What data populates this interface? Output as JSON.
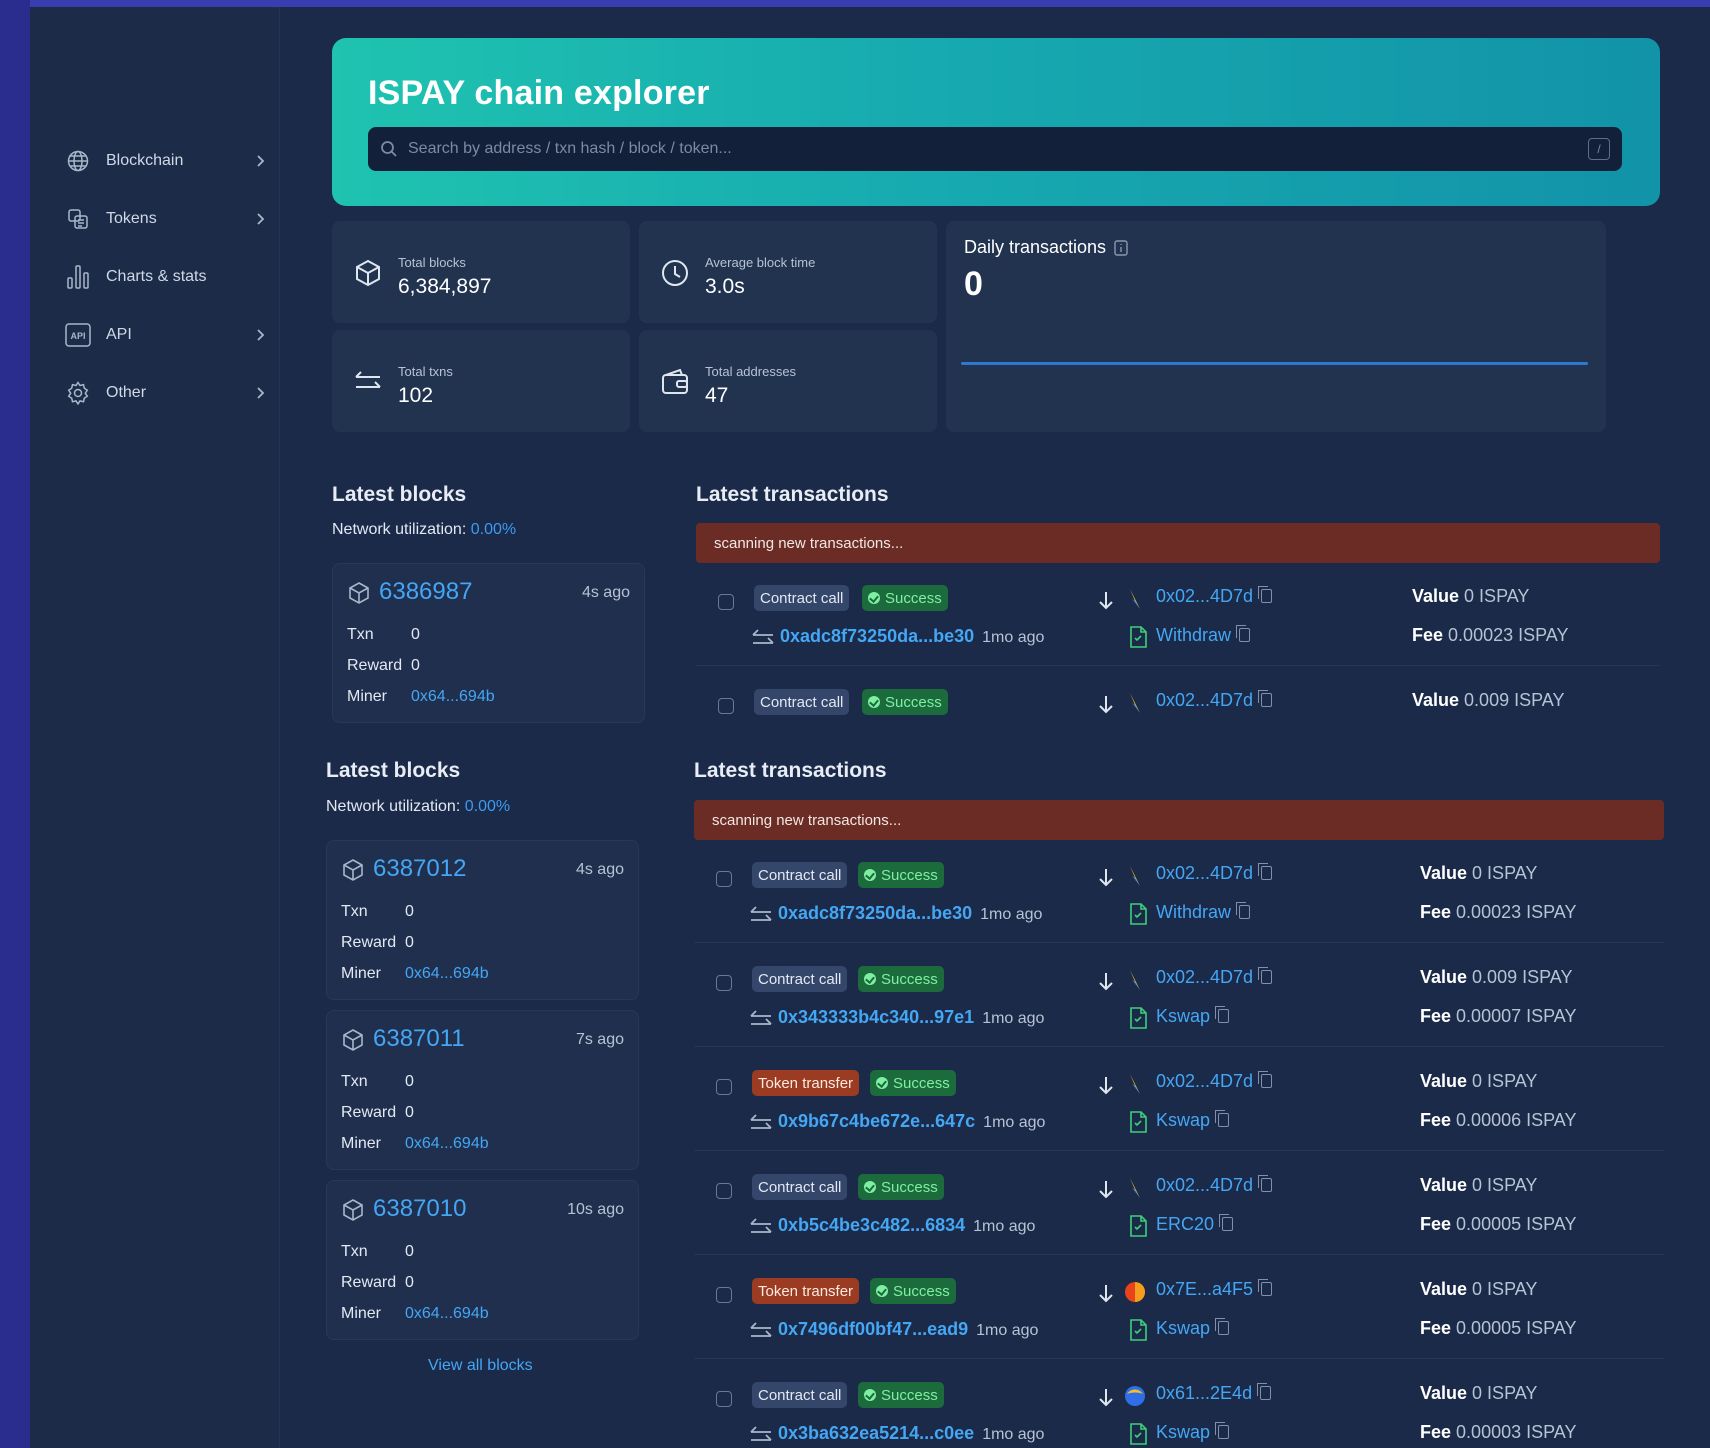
{
  "sidebar": {
    "items": [
      {
        "label": "Blockchain",
        "icon": "globe-icon",
        "has_chevron": true
      },
      {
        "label": "Tokens",
        "icon": "tokens-icon",
        "has_chevron": true
      },
      {
        "label": "Charts & stats",
        "icon": "chart-icon",
        "has_chevron": false
      },
      {
        "label": "API",
        "icon": "api-icon",
        "has_chevron": true
      },
      {
        "label": "Other",
        "icon": "gear-icon",
        "has_chevron": true
      }
    ]
  },
  "hero": {
    "title": "ISPAY chain explorer",
    "search_placeholder": "Search by address / txn hash / block / token...",
    "shortcut_key": "/"
  },
  "stats": {
    "total_blocks": {
      "label": "Total blocks",
      "value": "6,384,897"
    },
    "avg_block_time": {
      "label": "Average block time",
      "value": "3.0s"
    },
    "total_txns": {
      "label": "Total txns",
      "value": "102"
    },
    "total_addresses": {
      "label": "Total addresses",
      "value": "47"
    },
    "daily_transactions": {
      "label": "Daily transactions",
      "value": "0"
    }
  },
  "labels": {
    "txn": "Txn",
    "reward": "Reward",
    "miner": "Miner",
    "value": "Value",
    "fee": "Fee"
  },
  "panel_top": {
    "blocks_title": "Latest blocks",
    "network_utilization_label": "Network utilization:",
    "network_utilization_value": "0.00%",
    "transactions_title": "Latest transactions",
    "scanning_text": "scanning new transactions...",
    "blocks": [
      {
        "number": "6386987",
        "age": "4s ago",
        "txn": "0",
        "reward": "0",
        "miner": "0x64...694b"
      }
    ],
    "transactions": [
      {
        "type": "Contract call",
        "type_color": "#34466a",
        "status": "Success",
        "hash": "0xadc8f73250da...be30",
        "age": "1mo ago",
        "from": "0x02...4D7d",
        "token_icon": "bolt-token-icon",
        "method": "Withdraw",
        "value": "0 ISPAY",
        "fee": "0.00023 ISPAY"
      },
      {
        "type": "Contract call",
        "type_color": "#34466a",
        "status": "Success",
        "hash": "",
        "age": "",
        "from": "0x02...4D7d",
        "token_icon": "bolt-token-icon",
        "method": "",
        "value": "0.009 ISPAY",
        "fee": ""
      }
    ]
  },
  "panel_bottom": {
    "blocks_title": "Latest blocks",
    "network_utilization_label": "Network utilization:",
    "network_utilization_value": "0.00%",
    "transactions_title": "Latest transactions",
    "scanning_text": "scanning new transactions...",
    "view_all": "View all blocks",
    "blocks": [
      {
        "number": "6387012",
        "age": "4s ago",
        "txn": "0",
        "reward": "0",
        "miner": "0x64...694b"
      },
      {
        "number": "6387011",
        "age": "7s ago",
        "txn": "0",
        "reward": "0",
        "miner": "0x64...694b"
      },
      {
        "number": "6387010",
        "age": "10s ago",
        "txn": "0",
        "reward": "0",
        "miner": "0x64...694b"
      }
    ],
    "transactions": [
      {
        "type": "Contract call",
        "type_color": "#34466a",
        "status": "Success",
        "hash": "0xadc8f73250da...be30",
        "age": "1mo ago",
        "from": "0x02...4D7d",
        "token_icon": "bolt-token-icon",
        "method": "Withdraw",
        "value": "0 ISPAY",
        "fee": "0.00023 ISPAY"
      },
      {
        "type": "Contract call",
        "type_color": "#34466a",
        "status": "Success",
        "hash": "0x343333b4c340...97e1",
        "age": "1mo ago",
        "from": "0x02...4D7d",
        "token_icon": "bolt-token-icon",
        "method": "Kswap",
        "value": "0.009 ISPAY",
        "fee": "0.00007 ISPAY"
      },
      {
        "type": "Token transfer",
        "type_color": "#9a3b22",
        "status": "Success",
        "hash": "0x9b67c4be672e...647c",
        "age": "1mo ago",
        "from": "0x02...4D7d",
        "token_icon": "bolt-token-icon",
        "method": "Kswap",
        "value": "0 ISPAY",
        "fee": "0.00006 ISPAY"
      },
      {
        "type": "Contract call",
        "type_color": "#34466a",
        "status": "Success",
        "hash": "0xb5c4be3c482...6834",
        "age": "1mo ago",
        "from": "0x02...4D7d",
        "token_icon": "bolt-token-icon",
        "method": "ERC20",
        "value": "0 ISPAY",
        "fee": "0.00005 ISPAY"
      },
      {
        "type": "Token transfer",
        "type_color": "#9a3b22",
        "status": "Success",
        "hash": "0x7496df00bf47...ead9",
        "age": "1mo ago",
        "from": "0x7E...a4F5",
        "token_icon": "flame-token-icon",
        "method": "Kswap",
        "value": "0 ISPAY",
        "fee": "0.00005 ISPAY"
      },
      {
        "type": "Contract call",
        "type_color": "#34466a",
        "status": "Success",
        "hash": "0x3ba632ea5214...c0ee",
        "age": "1mo ago",
        "from": "0x61...2E4d",
        "token_icon": "globe-token-icon",
        "method": "Kswap",
        "value": "0 ISPAY",
        "fee": "0.00003 ISPAY"
      }
    ]
  },
  "colors": {
    "accent": "#45a6f4",
    "hero_start": "#1fc3b0",
    "hero_end": "#1293a8",
    "scan_banner": "#6a2c24",
    "success": "#7ff0a2"
  }
}
